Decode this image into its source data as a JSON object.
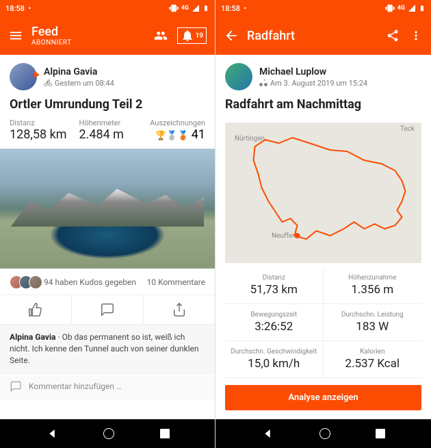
{
  "status": {
    "time": "18:58",
    "net": "4G"
  },
  "left": {
    "header": {
      "title": "Feed",
      "subtitle": "ABONNIERT",
      "notif_count": "19"
    },
    "user": {
      "name": "Alpina Gavia",
      "meta": "Gestern um 08:44"
    },
    "activity_title": "Ortler Umrundung Teil 2",
    "stats": {
      "distance_label": "Distanz",
      "distance_value": "128,58 km",
      "elev_label": "Höhenmeter",
      "elev_value": "2.484 m",
      "awards_label": "Auszeichnungen",
      "awards_value": "41"
    },
    "kudos": {
      "text": "94 haben Kudos gegeben",
      "comments": "10 Kommentare"
    },
    "comment": {
      "author": "Alpina Gavia",
      "sep": " · ",
      "body": "Ob das permanent so ist, weiß ich nicht. Ich kenne den Tunnel auch von seiner dunklen Seite."
    },
    "comment_input": "Kommentar hinzufügen …"
  },
  "right": {
    "header": {
      "title": "Radfahrt"
    },
    "user": {
      "name": "Michael Luplow",
      "meta": "Am 3. August 2019 um 15:24"
    },
    "activity_title": "Radfahrt am Nachmittag",
    "map_labels": {
      "top": "Nürtingen",
      "bottom": "Neuffen",
      "topright": "Teck"
    },
    "grid": {
      "r0l": "Distanz",
      "r0v": "51,73 km",
      "r1l": "Höhenzunahme",
      "r1v": "1.356 m",
      "r2l": "Bewegungszeit",
      "r2v": "3:26:52",
      "r3l": "Durchschn. Leistung",
      "r3v": "183 W",
      "r4l": "Durchschn. Geschwindigkeit",
      "r4v": "15,0 km/h",
      "r5l": "Kalorien",
      "r5v": "2.537 Kcal"
    },
    "button": "Analyse anzeigen"
  }
}
